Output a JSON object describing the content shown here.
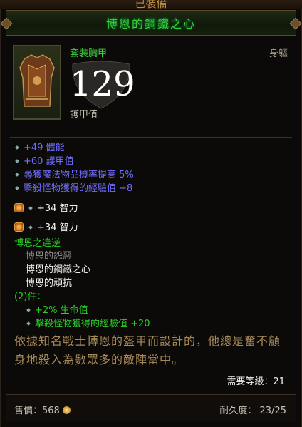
{
  "header_label": "已裝備",
  "item_name": "博恩的鋼鐵之心",
  "item_type": "套裝胸甲",
  "slot": "身軀",
  "armor_value": "129",
  "armor_label": "護甲值",
  "primary_stats": [
    "+49 體能",
    "+60 護甲值",
    "尋獲魔法物品機率提高 5%",
    "擊殺怪物獲得的經驗值 +8"
  ],
  "sockets": [
    "+34 智力",
    "+34 智力"
  ],
  "set": {
    "name": "博恩之違逆",
    "pieces": [
      "博恩的怨惡",
      "博恩的鋼鐵之心",
      "博恩的頑抗"
    ],
    "bonus_header": "(2)件：",
    "bonuses": [
      "+2% 生命值",
      "擊殺怪物獲得的經驗值 +20"
    ]
  },
  "flavor_text": "依據知名戰士博恩的盔甲而設計的，他總是奮不顧身地殺入為數眾多的敵陣當中。",
  "required_level_label": "需要等級：21",
  "footer": {
    "price_label": "售價：568",
    "durability_label": "耐久度：",
    "durability_value": "23/25"
  },
  "colors": {
    "set_green": "#28d028",
    "magic_blue": "#7070ff",
    "gold": "#b88a44"
  }
}
